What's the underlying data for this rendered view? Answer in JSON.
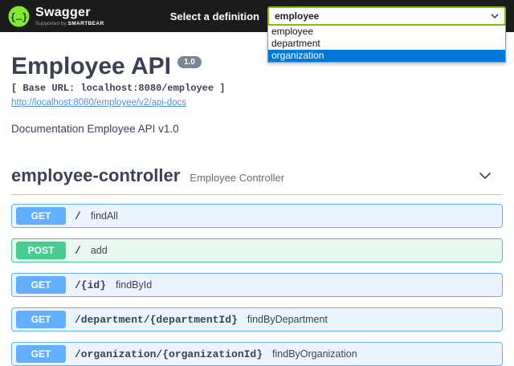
{
  "topbar": {
    "brand": "Swagger",
    "supported_by": "Supported by",
    "smartbear": "SMARTBEAR",
    "select_label": "Select a definition",
    "select_value": "employee",
    "dropdown_options": [
      {
        "label": "employee",
        "highlighted": false
      },
      {
        "label": "department",
        "highlighted": false
      },
      {
        "label": "organization",
        "highlighted": true
      }
    ]
  },
  "info": {
    "title": "Employee API",
    "version": "1.0",
    "base_url": "[ Base URL: localhost:8080/employee ]",
    "api_docs_link": "http://localhost:8080/employee/v2/api-docs",
    "description": "Documentation Employee API v1.0"
  },
  "tag": {
    "name": "employee-controller",
    "description": "Employee Controller"
  },
  "operations": [
    {
      "method": "GET",
      "path": "/",
      "summary": "findAll"
    },
    {
      "method": "POST",
      "path": "/",
      "summary": "add"
    },
    {
      "method": "GET",
      "path": "/{id}",
      "summary": "findById"
    },
    {
      "method": "GET",
      "path": "/department/{departmentId}",
      "summary": "findByDepartment"
    },
    {
      "method": "GET",
      "path": "/organization/{organizationId}",
      "summary": "findByOrganization"
    }
  ],
  "colors": {
    "topbar_bg": "#1b1b1b",
    "brand_green": "#85ea2d",
    "select_border": "#89bf04",
    "get": "#61affe",
    "post": "#49cc90",
    "text": "#3b4151",
    "link": "#4990e2",
    "version_badge_bg": "#7d8492",
    "dropdown_highlight": "#0078d7"
  }
}
